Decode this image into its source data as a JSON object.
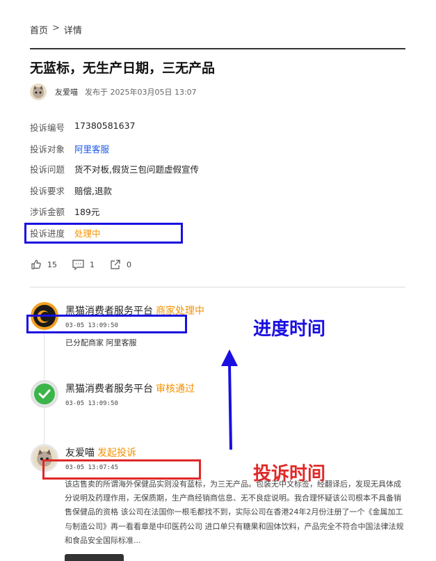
{
  "breadcrumb": {
    "home": "首页",
    "separator": ">",
    "current": "详情"
  },
  "title": "无蓝标，无生产日期，三无产品",
  "author": {
    "name": "友爱喵",
    "published": "发布于 2025年03月05日 13:07"
  },
  "details": [
    {
      "label": "投诉编号",
      "value": "17380581637"
    },
    {
      "label": "投诉对象",
      "value": "阿里客服"
    },
    {
      "label": "投诉问题",
      "value": "货不对板,假货三包问题虚假宣传"
    },
    {
      "label": "投诉要求",
      "value": "赔偿,退款"
    },
    {
      "label": "涉诉金额",
      "value": "189元"
    },
    {
      "label": "投诉进度",
      "value": "处理中"
    }
  ],
  "actions": {
    "likes": "15",
    "comments": "1",
    "shares": "0"
  },
  "timeline": [
    {
      "actor": "黑猫消费者服务平台",
      "status": "商家处理中",
      "time": "03-05 13:09:50",
      "desc": "已分配商家 阿里客服"
    },
    {
      "actor": "黑猫消费者服务平台",
      "status": "审核通过",
      "time": "03-05 13:09:50"
    },
    {
      "actor": "友爱喵",
      "status": "发起投诉",
      "time": "03-05 13:07:45",
      "desc": "该店售卖的所谓海外保健品实则没有蓝标，为三无产品。包装无中文标签，经翻译后，发现无具体成分说明及药理作用，无保质期，生产商经销商信息、无不良症说明。我合理怀疑该公司根本不具备销售保健品的资格 该公司在法国你一根毛都找不到，实际公司在香港24年2月份注册了一个《金属加工与制造公司》再一看看章是中印医药公司 进口单只有糖果和固体饮料，产品完全不符合中国法律法规和食品安全国际标准..."
    }
  ],
  "annotations": {
    "progress_time": "进度时间",
    "complaint_time": "投诉时间"
  },
  "colors": {
    "accent_orange": "#f39200",
    "link_blue": "#1a56e8",
    "annot_blue": "#1a0fe0",
    "annot_red": "#e02828"
  }
}
